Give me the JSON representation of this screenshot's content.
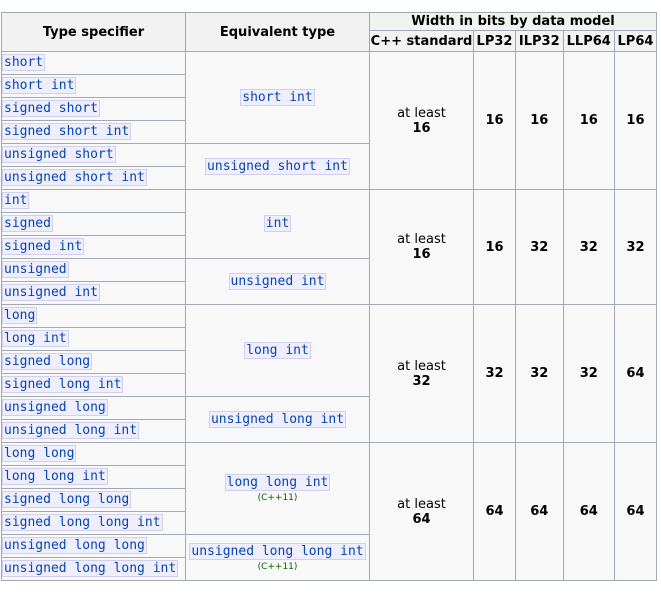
{
  "headers": {
    "type_specifier": "Type specifier",
    "equivalent_type": "Equivalent type",
    "width_bits": "Width in bits by data model",
    "cpp_standard": "C++ standard",
    "lp32": "LP32",
    "ilp32": "ILP32",
    "llp64": "LLP64",
    "lp64": "LP64"
  },
  "groups": [
    {
      "specs": [
        "short",
        "short int",
        "signed short",
        "signed short int",
        "unsigned short",
        "unsigned short int"
      ],
      "equiv_signed": "short int",
      "equiv_signed_note": "",
      "equiv_unsigned": "unsigned short int",
      "equiv_unsigned_note": "",
      "std_prefix": "at least",
      "std_value": "16",
      "lp32": "16",
      "ilp32": "16",
      "llp64": "16",
      "lp64": "16"
    },
    {
      "specs": [
        "int",
        "signed",
        "signed int",
        "unsigned",
        "unsigned int"
      ],
      "equiv_signed": "int",
      "equiv_signed_note": "",
      "equiv_unsigned": "unsigned int",
      "equiv_unsigned_note": "",
      "std_prefix": "at least",
      "std_value": "16",
      "lp32": "16",
      "ilp32": "32",
      "llp64": "32",
      "lp64": "32"
    },
    {
      "specs": [
        "long",
        "long int",
        "signed long",
        "signed long int",
        "unsigned long",
        "unsigned long int"
      ],
      "equiv_signed": "long int",
      "equiv_signed_note": "",
      "equiv_unsigned": "unsigned long int",
      "equiv_unsigned_note": "",
      "std_prefix": "at least",
      "std_value": "32",
      "lp32": "32",
      "ilp32": "32",
      "llp64": "32",
      "lp64": "64"
    },
    {
      "specs": [
        "long long",
        "long long int",
        "signed long long",
        "signed long long int",
        "unsigned long long",
        "unsigned long long int"
      ],
      "equiv_signed": "long long int",
      "equiv_signed_note": "(C++11)",
      "equiv_unsigned": "unsigned long long int",
      "equiv_unsigned_note": "(C++11)",
      "std_prefix": "at least",
      "std_value": "64",
      "lp32": "64",
      "ilp32": "64",
      "llp64": "64",
      "lp64": "64"
    }
  ]
}
